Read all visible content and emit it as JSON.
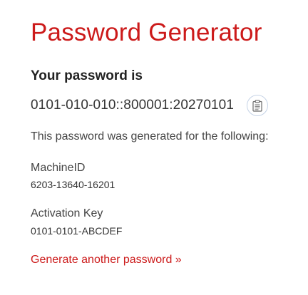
{
  "header": {
    "title": "Password Generator"
  },
  "result": {
    "heading": "Your password is",
    "password": "0101-010-010::800001:20270101",
    "copy_icon": "clipboard-icon"
  },
  "details": {
    "description": "This password was generated for the following:",
    "machine_id_label": "MachineID",
    "machine_id_value": "6203-13640-16201",
    "activation_key_label": "Activation Key",
    "activation_key_value": "0101-0101-ABCDEF"
  },
  "actions": {
    "generate_another_label": "Generate another password »"
  },
  "colors": {
    "accent": "#cc1a1a",
    "text": "#333333",
    "icon_border": "#c5d3e6"
  }
}
